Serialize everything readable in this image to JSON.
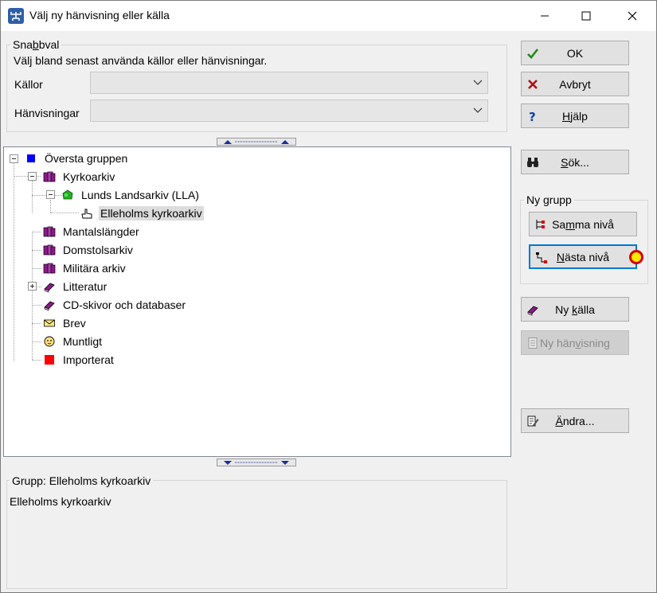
{
  "window": {
    "title": "Välj ny hänvisning eller källa"
  },
  "snabbval": {
    "legend_pre": "Sna",
    "legend_u": "b",
    "legend_post": "bval",
    "description": "Välj bland senast använda källor eller hänvisningar.",
    "kallor_label": "Källor",
    "kallor_value": "",
    "hanvisningar_label": "Hänvisningar",
    "hanvisningar_value": ""
  },
  "tree": {
    "root": "Översta gruppen",
    "kyrkoarkiv": "Kyrkoarkiv",
    "lunds": "Lunds Landsarkiv (LLA)",
    "elleholms": "Elleholms kyrkoarkiv",
    "mantal": "Mantalslängder",
    "domstol": "Domstolsarkiv",
    "militara": "Militära arkiv",
    "litteratur": "Litteratur",
    "cd": "CD-skivor och databaser",
    "brev": "Brev",
    "muntligt": "Muntligt",
    "importerat": "Importerat"
  },
  "info": {
    "group_label": "Grupp: Elleholms kyrkoarkiv",
    "text": "Elleholms kyrkoarkiv"
  },
  "buttons": {
    "ok": "OK",
    "avbryt": "Avbryt",
    "hjalp_pre": "",
    "hjalp_u": "H",
    "hjalp_post": "jälp",
    "sok_pre": "",
    "sok_u": "S",
    "sok_post": "ök...",
    "ny_grupp_legend": "Ny grupp",
    "samma_pre": "Sa",
    "samma_u": "m",
    "samma_post": "ma nivå",
    "nasta_pre": "",
    "nasta_u": "N",
    "nasta_post": "ästa nivå",
    "ny_kalla_pre": "Ny ",
    "ny_kalla_u": "k",
    "ny_kalla_post": "älla",
    "ny_hanv_pre": "Ny hän",
    "ny_hanv_u": "v",
    "ny_hanv_post": "isning",
    "andra_pre": "",
    "andra_u": "Ä",
    "andra_post": "ndra..."
  },
  "colors": {
    "accent": "#0078d7",
    "folder_root": "#0000ff",
    "book_purple": "#8b1a8b",
    "imported_red": "#ff0000"
  }
}
